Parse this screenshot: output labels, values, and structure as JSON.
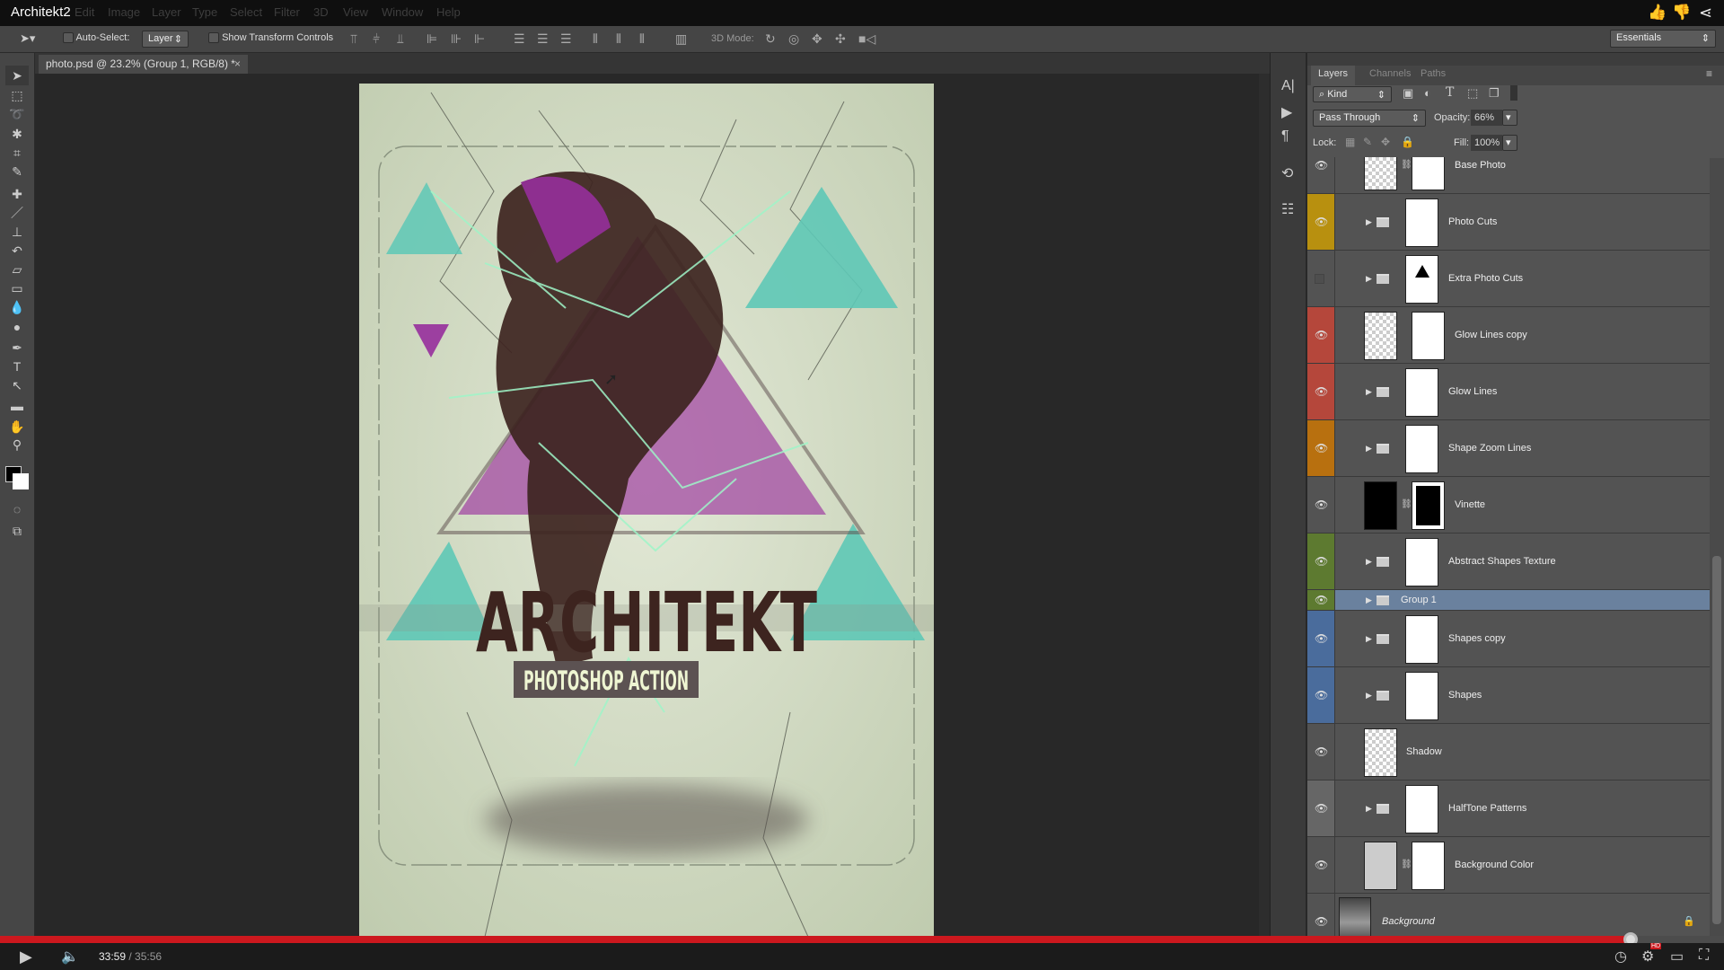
{
  "title_bar": {
    "title": "Architekt2",
    "menu": [
      "Edit",
      "Image",
      "Layer",
      "Type",
      "Select",
      "Filter",
      "3D",
      "View",
      "Window",
      "Help"
    ],
    "video_actions": [
      "like-icon",
      "dislike-icon",
      "share-icon"
    ]
  },
  "options_bar": {
    "auto_select_label": "Auto-Select:",
    "auto_select_checked": false,
    "auto_select_target": "Layer",
    "show_transform_label": "Show Transform Controls",
    "show_transform_checked": false,
    "mode_3d_label": "3D Mode:",
    "workspace": "Essentials"
  },
  "document": {
    "tab_title": "photo.psd @ 23.2% (Group 1, RGB/8) *",
    "close": "×"
  },
  "toolbar": {
    "tools": [
      "move",
      "marquee",
      "lasso",
      "magic-wand",
      "crop",
      "eyedropper",
      "healing-brush",
      "brush",
      "clone-stamp",
      "history-brush",
      "eraser",
      "gradient",
      "blur",
      "dodge",
      "pen",
      "type",
      "path-selection",
      "rectangle",
      "hand",
      "zoom"
    ],
    "foreground": "#000000",
    "background": "#ffffff"
  },
  "artwork": {
    "title": "ARCHITEKT",
    "subtitle": "PHOTOSHOP ACTION",
    "colors": {
      "bg": "#c9d4b8",
      "teal": "#5ec8b6",
      "purple": "#9c3fa0",
      "dark": "#3d241f"
    }
  },
  "layers_panel": {
    "tabs": [
      "Layers",
      "Channels",
      "Paths"
    ],
    "filter_kind": "Kind",
    "blend_mode": "Pass Through",
    "opacity_label": "Opacity:",
    "opacity": "66%",
    "lock_label": "Lock:",
    "fill_label": "Fill:",
    "fill": "100%",
    "layers": [
      {
        "name": "Base Photo",
        "visible": true,
        "color": "",
        "kind": "linked",
        "thumb": "photo"
      },
      {
        "name": "Photo Cuts",
        "visible": true,
        "color": "#b8900f",
        "kind": "group"
      },
      {
        "name": "Extra Photo Cuts",
        "visible": false,
        "color": "",
        "kind": "group",
        "thumb": "triangle"
      },
      {
        "name": "Glow Lines copy",
        "visible": true,
        "color": "#b5473b",
        "kind": "masked",
        "thumb": "glow"
      },
      {
        "name": "Glow Lines",
        "visible": true,
        "color": "#b5473b",
        "kind": "group"
      },
      {
        "name": "Shape Zoom Lines",
        "visible": true,
        "color": "#b8700f",
        "kind": "group"
      },
      {
        "name": "Vinette",
        "visible": true,
        "color": "",
        "kind": "linked",
        "thumb": "black"
      },
      {
        "name": "Abstract Shapes Texture",
        "visible": true,
        "color": "#5d7a30",
        "kind": "group"
      },
      {
        "name": "Group 1",
        "visible": true,
        "color": "#5d7a30",
        "kind": "group-collapsed",
        "selected": true
      },
      {
        "name": "Shapes copy",
        "visible": true,
        "color": "#4a6c9c",
        "kind": "group"
      },
      {
        "name": "Shapes",
        "visible": true,
        "color": "#4a6c9c",
        "kind": "group"
      },
      {
        "name": "Shadow",
        "visible": true,
        "color": "",
        "kind": "layer",
        "thumb": "checker"
      },
      {
        "name": "HalfTone Patterns",
        "visible": true,
        "color": "#666666",
        "kind": "group"
      },
      {
        "name": "Background Color",
        "visible": true,
        "color": "",
        "kind": "linked",
        "thumb": "fill"
      },
      {
        "name": "Background",
        "visible": true,
        "color": "",
        "kind": "background",
        "locked": true,
        "thumb": "photo"
      }
    ]
  },
  "video": {
    "current_time": "33:59",
    "separator": " / ",
    "duration": "35:56",
    "progress": 0.9457,
    "accent": "#cc181e",
    "hd_badge": "HD"
  }
}
